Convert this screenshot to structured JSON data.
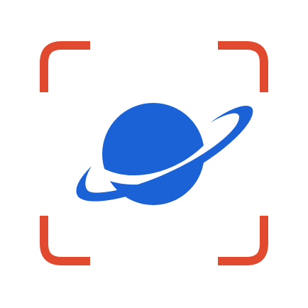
{
  "app": {
    "icon_name": "planet-scan-icon"
  },
  "colors": {
    "background": "#ffffff",
    "frame": "#e14a2f",
    "planet": "#1b62d6"
  },
  "icons": {
    "frame_corners": "scan-frame-corner-icon",
    "planet": "planet-icon",
    "ring": "planet-ring-icon"
  }
}
